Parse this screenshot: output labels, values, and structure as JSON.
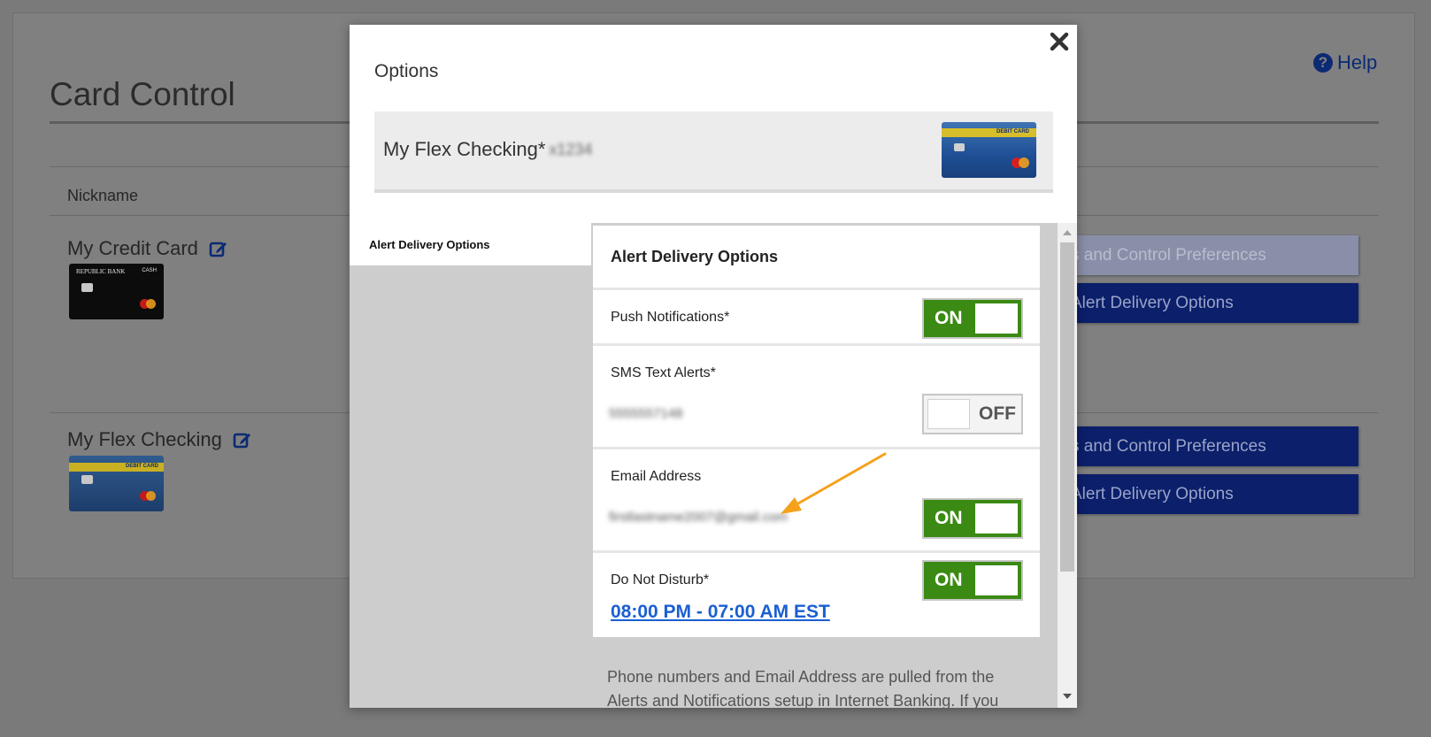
{
  "background": {
    "page_title": "Card Control",
    "help_label": "Help",
    "column_header": "Nickname",
    "cards": [
      {
        "nickname": "My Credit Card",
        "card_bank_text": "REPUBLIC BANK",
        "card_type_text": "CASH",
        "buttons": [
          "s and Control Preferences",
          "Alert Delivery Options"
        ]
      },
      {
        "nickname": "My Flex Checking",
        "card_type_text": "DEBIT CARD",
        "buttons": [
          "s and Control Preferences",
          "Alert Delivery Options"
        ]
      }
    ]
  },
  "modal": {
    "title": "Options",
    "close_icon": "close-icon",
    "account": {
      "name": "My Flex Checking*",
      "masked_suffix": "x1234",
      "card_label": "DEBIT CARD"
    },
    "left_tab": "Alert Delivery Options",
    "section_title": "Alert Delivery Options",
    "options": {
      "push": {
        "label": "Push Notifications*",
        "state": "ON"
      },
      "sms": {
        "label": "SMS Text Alerts*",
        "value": "5555557148",
        "state": "OFF"
      },
      "email": {
        "label": "Email Address",
        "value": "firstlastname2007@gmail.com",
        "state": "ON"
      },
      "dnd": {
        "label": "Do Not Disturb*",
        "state": "ON",
        "schedule": "08:00 PM - 07:00 AM EST"
      }
    },
    "footnote": "Phone numbers and Email Address are pulled from the Alerts and Notifications setup in Internet Banking. If you"
  },
  "colors": {
    "toggle_on": "#3a8a13",
    "primary_button": "#0b1f6b",
    "link": "#1a5fd1",
    "annotation_arrow": "#f5a11c"
  }
}
